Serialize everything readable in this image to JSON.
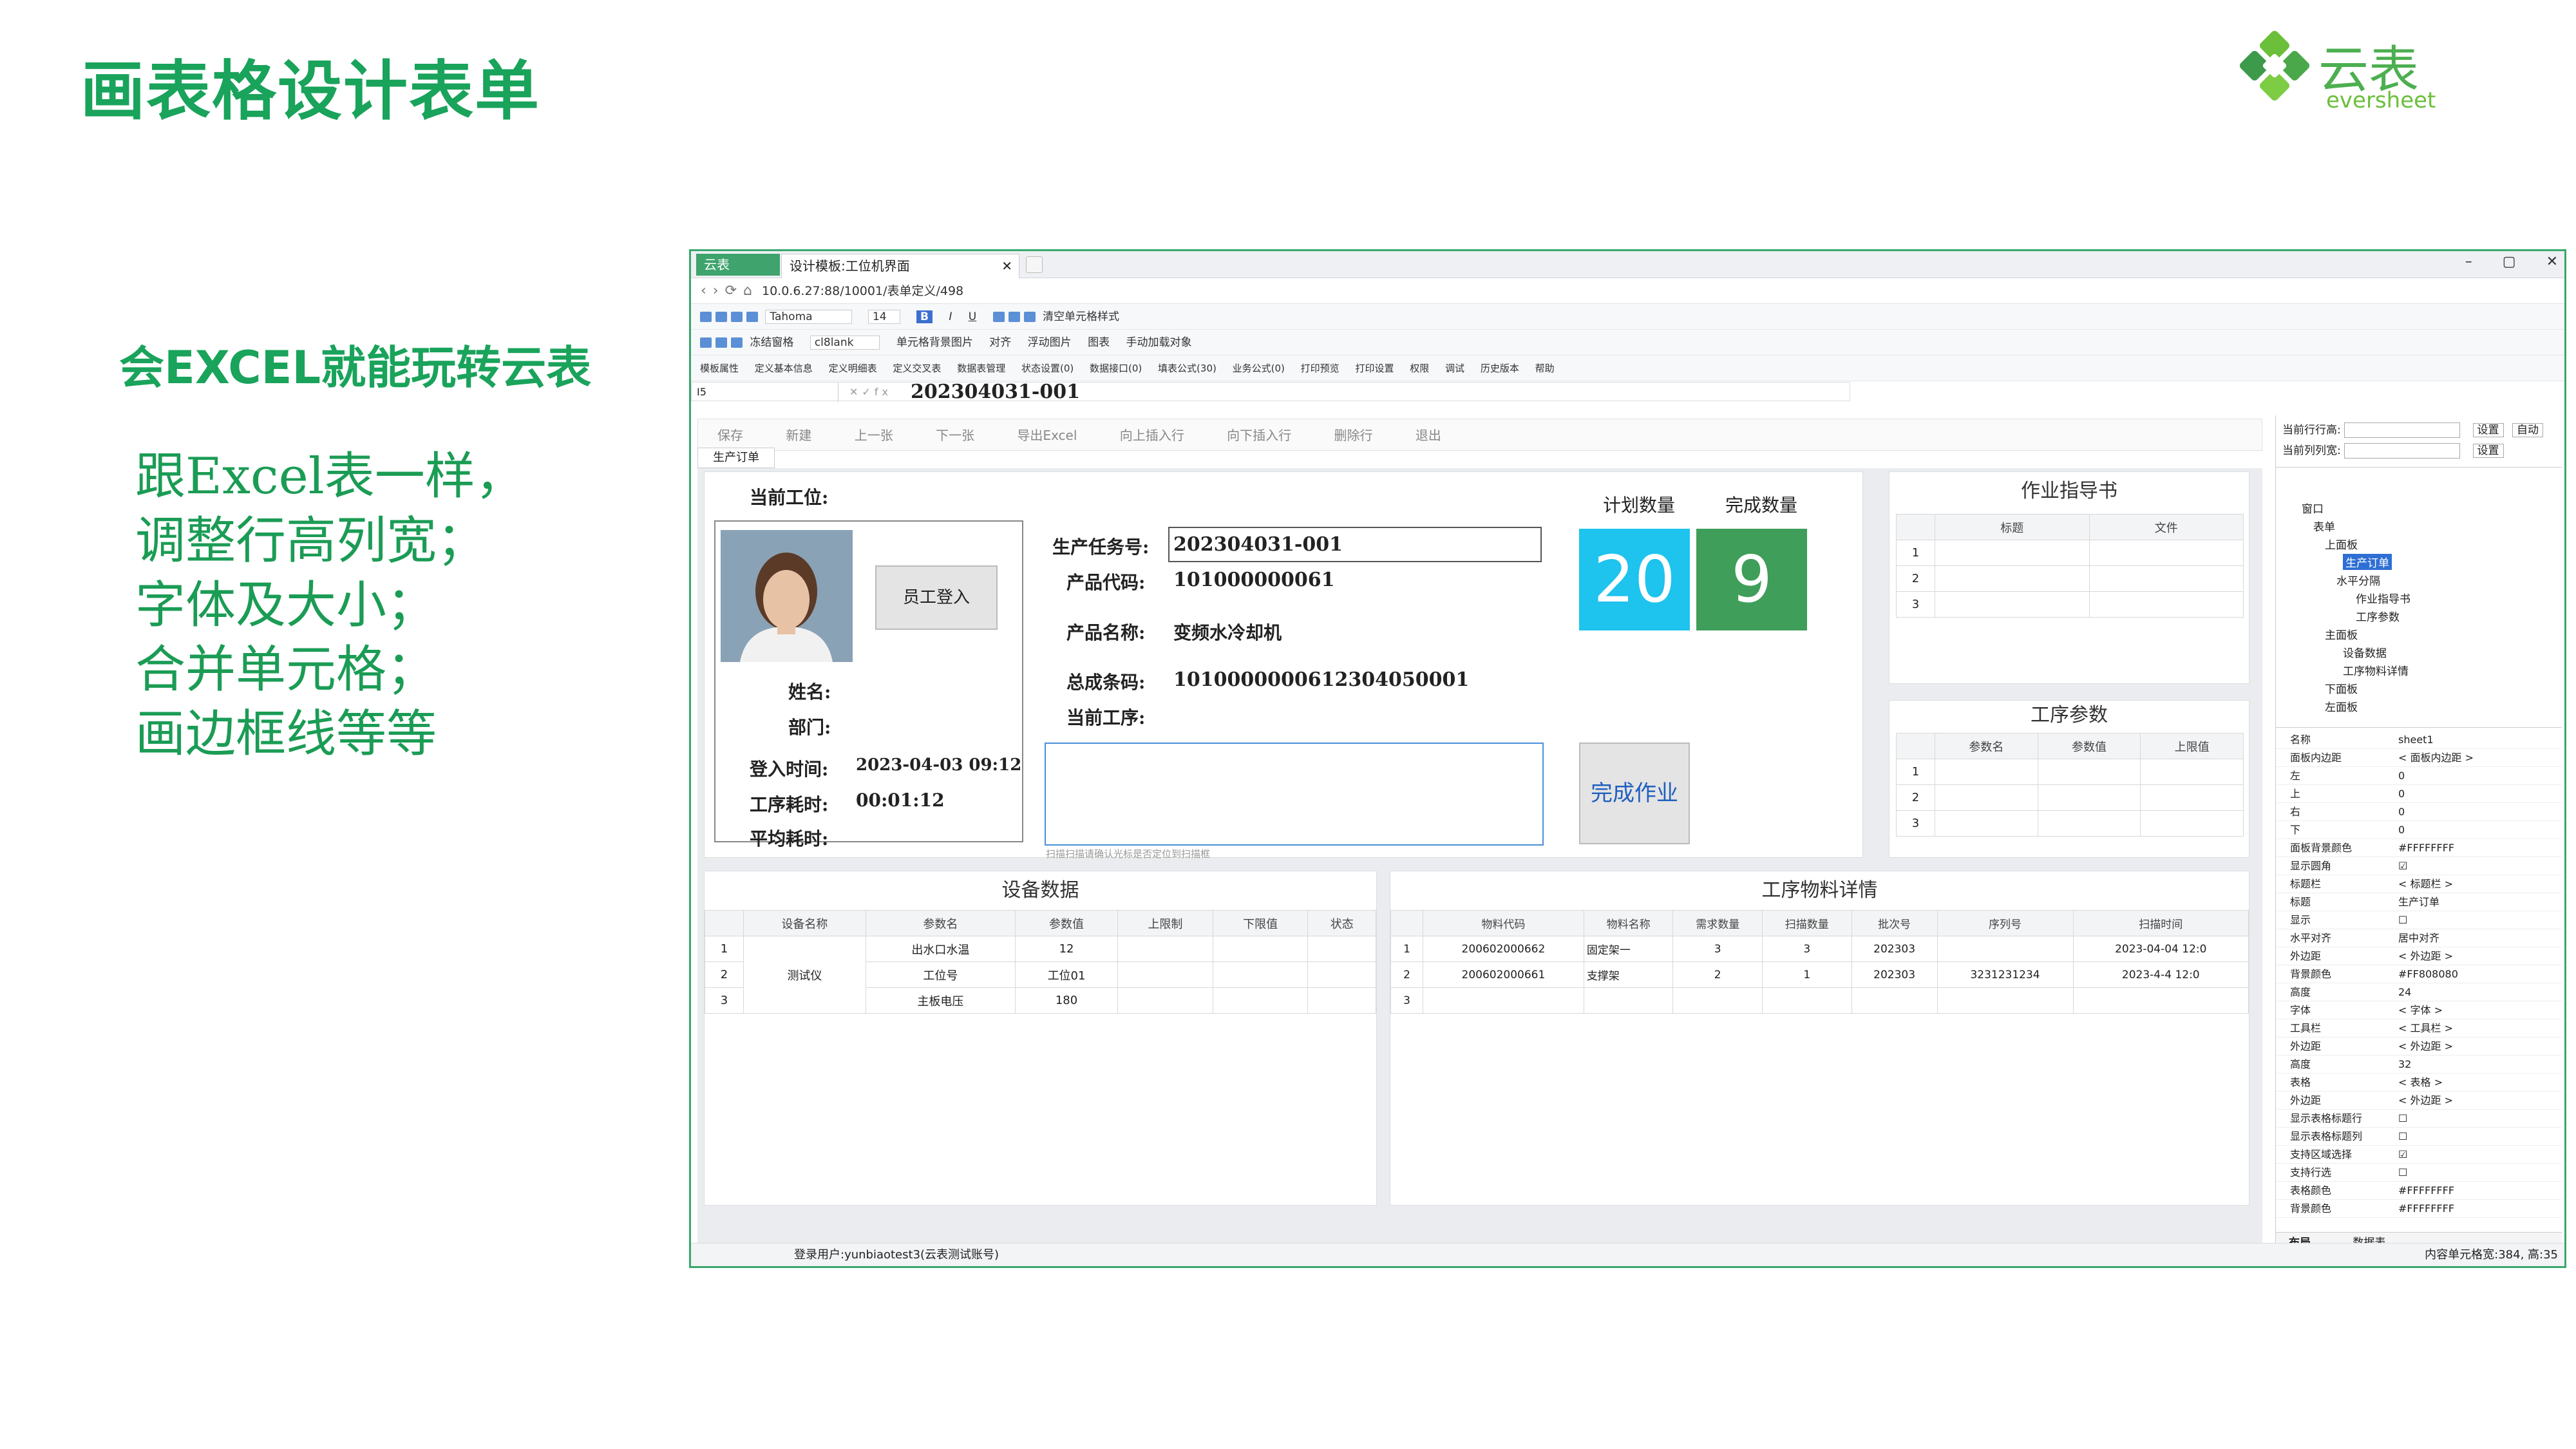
{
  "slide": {
    "title": "画表格设计表单",
    "subtitle": "会EXCEL就能玩转云表",
    "bullets": [
      "跟Excel表一样，",
      "调整行高列宽；",
      "字体及大小；",
      "合并单元格；",
      "画边框线等等"
    ],
    "logo_cn": "云表",
    "logo_en": "eversheet"
  },
  "colors": {
    "brand": "#19a35b",
    "cyan": "#1ec3ee",
    "green": "#3f9e5a",
    "window_border": "#3aa76d"
  },
  "app": {
    "app_tab": "云表",
    "doc_tab": "设计模板:工位机界面",
    "address": "10.0.6.27:88/10001/表单定义/498",
    "toolbar1": [
      "Tahoma",
      "14",
      "B",
      "I",
      "U",
      "清空单元格样式"
    ],
    "toolbar2": [
      "冻结窗格",
      "cl8lank",
      "单元格背景图片",
      "对齐",
      "浮动图片",
      "图表",
      "手动加载对象"
    ],
    "toolbar3": [
      "模板属性",
      "定义基本信息",
      "定义明细表",
      "定义交叉表",
      "数据表管理",
      "状态设置(0)",
      "数据接口(0)",
      "填表公式(30)",
      "业务公式(0)",
      "打印预览",
      "打印设置",
      "权限",
      "调试",
      "历史版本",
      "帮助"
    ],
    "cell_ref": "I5",
    "formula_value": "202304031-001",
    "commands": [
      "保存",
      "新建",
      "上一张",
      "下一张",
      "导出Excel",
      "向上插入行",
      "向下插入行",
      "删除行",
      "退出"
    ],
    "sheet_tab": "生产订单",
    "status_user": "登录用户:yunbiaotest3(云表测试账号)",
    "status_right": "内容单元格宽:384, 高:35"
  },
  "form": {
    "station_label": "当前工位:",
    "login_button": "员工登入",
    "name_label": "姓名:",
    "dept_label": "部门:",
    "login_time_label": "登入时间:",
    "login_time": "2023-04-03 09:12",
    "proc_time_label": "工序耗时:",
    "proc_time": "00:01:12",
    "avg_time_label": "平均耗时:",
    "task_label": "生产任务号:",
    "task_no": "202304031-001",
    "product_code_label": "产品代码:",
    "product_code": "101000000061",
    "product_name_label": "产品名称:",
    "product_name": "变频水冷却机",
    "barcode_label": "总成条码:",
    "barcode": "1010000000612304050001",
    "current_proc_label": "当前工序:",
    "scan_hint": "扫描扫描请确认光标是否定位到扫描框",
    "plan_qty_label": "计划数量",
    "plan_qty": "20",
    "done_qty_label": "完成数量",
    "done_qty": "9",
    "finish_button": "完成作业"
  },
  "guide": {
    "title": "作业指导书",
    "headers": [
      "标题",
      "文件"
    ],
    "rows": [
      "1",
      "2",
      "3"
    ]
  },
  "params": {
    "title": "工序参数",
    "headers": [
      "参数名",
      "参数值",
      "上限值"
    ],
    "rows": [
      "1",
      "2",
      "3"
    ]
  },
  "equipment": {
    "title": "设备数据",
    "headers": [
      "",
      "设备名称",
      "参数名",
      "参数值",
      "上限制",
      "下限值",
      "状态"
    ],
    "device": "测试仪",
    "rows": [
      {
        "n": "1",
        "param": "出水口水温",
        "value": "12"
      },
      {
        "n": "2",
        "param": "工位号",
        "value": "工位01"
      },
      {
        "n": "3",
        "param": "主板电压",
        "value": "180"
      }
    ]
  },
  "materials": {
    "title": "工序物料详情",
    "headers": [
      "",
      "物料代码",
      "物料名称",
      "需求数量",
      "扫描数量",
      "批次号",
      "序列号",
      "扫描时间"
    ],
    "rows": [
      {
        "n": "1",
        "code": "200602000662",
        "name": "固定架一",
        "need": "3",
        "scan": "3",
        "batch": "202303",
        "serial": "",
        "time": "2023-04-04 12:0"
      },
      {
        "n": "2",
        "code": "200602000661",
        "name": "支撑架",
        "need": "2",
        "scan": "1",
        "batch": "202303",
        "serial": "3231231234",
        "time": "2023-4-4 12:0"
      },
      {
        "n": "3",
        "code": "",
        "name": "",
        "need": "",
        "scan": "",
        "batch": "",
        "serial": "",
        "time": ""
      }
    ]
  },
  "side": {
    "row_height_label": "当前行行高:",
    "col_width_label": "当前列列宽:",
    "set": "设置",
    "auto": "自动",
    "tree": [
      "窗口",
      "表单",
      "上面板",
      "生产订单",
      "水平分隔",
      "作业指导书",
      "工序参数",
      "主面板",
      "设备数据",
      "工序物料详情",
      "下面板",
      "左面板"
    ],
    "props": [
      [
        "名称",
        "sheet1"
      ],
      [
        "面板内边距",
        "< 面板内边距 >"
      ],
      [
        "左",
        "0"
      ],
      [
        "上",
        "0"
      ],
      [
        "右",
        "0"
      ],
      [
        "下",
        "0"
      ],
      [
        "面板背景颜色",
        "#FFFFFFFF"
      ],
      [
        "显示圆角",
        "☑"
      ],
      [
        "标题栏",
        "< 标题栏 >"
      ],
      [
        "标题",
        "生产订单"
      ],
      [
        "显示",
        "☐"
      ],
      [
        "水平对齐",
        "居中对齐"
      ],
      [
        "外边距",
        "< 外边距 >"
      ],
      [
        "背景颜色",
        "#FF808080"
      ],
      [
        "高度",
        "24"
      ],
      [
        "字体",
        "< 字体 >"
      ],
      [
        "工具栏",
        "< 工具栏 >"
      ],
      [
        "外边距",
        "< 外边距 >"
      ],
      [
        "高度",
        "32"
      ],
      [
        "表格",
        "< 表格 >"
      ],
      [
        "外边距",
        "< 外边距 >"
      ],
      [
        "显示表格标题行",
        "☐"
      ],
      [
        "显示表格标题列",
        "☐"
      ],
      [
        "支持区域选择",
        "☑"
      ],
      [
        "支持行选",
        "☐"
      ],
      [
        "表格颜色",
        "#FFFFFFFF"
      ],
      [
        "背景颜色",
        "#FFFFFFFF"
      ]
    ],
    "bottom_tabs": [
      "布局",
      "数据表"
    ]
  }
}
